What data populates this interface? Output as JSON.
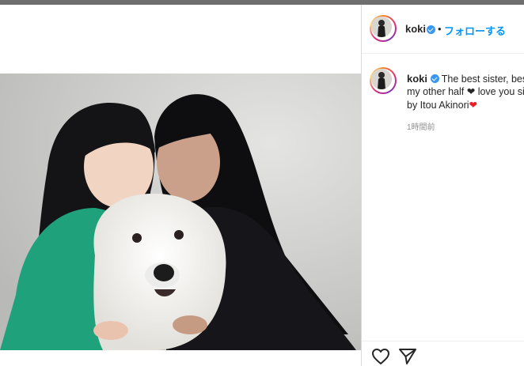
{
  "post": {
    "username": "koki",
    "separator": "•",
    "follow_label": "フォローする",
    "caption_lines": [
      "The best sister, best",
      "my other half",
      " love you sis",
      "by Itou Akinori"
    ],
    "hearts": {
      "inline": "❤",
      "end": "❤"
    },
    "timestamp": "1時間前"
  },
  "icons": {
    "verified": "verified-badge-icon",
    "like": "heart-outline-icon",
    "share": "paper-plane-icon"
  },
  "colors": {
    "accent": "#0095f6",
    "verified": "#3897f0",
    "heart_red": "#ed1c24",
    "topbar": "#6f6f6f"
  }
}
